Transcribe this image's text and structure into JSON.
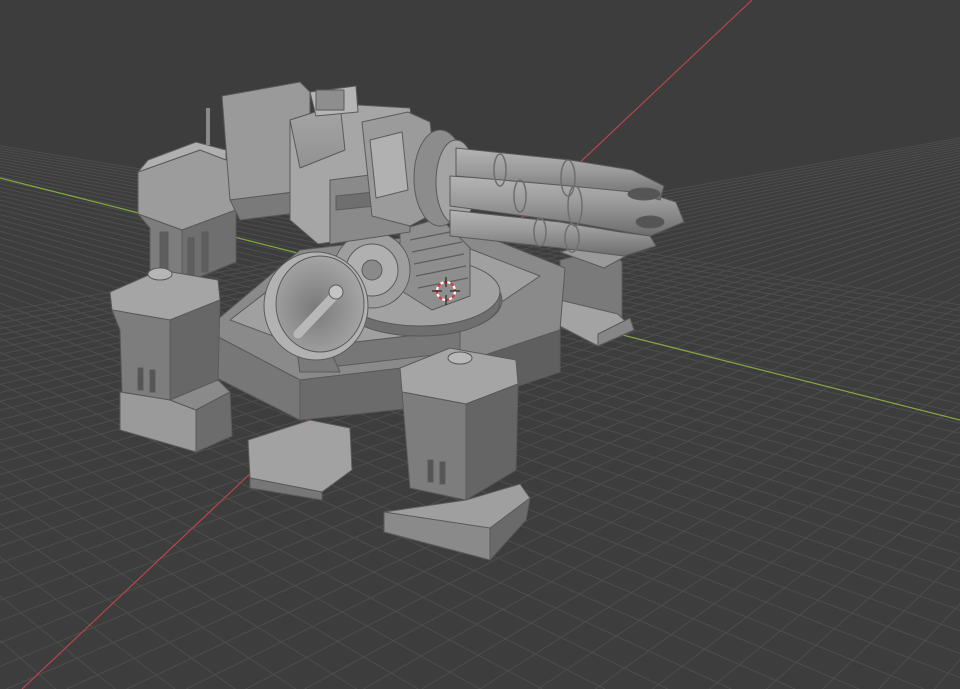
{
  "viewport": {
    "kind": "3D Viewport",
    "mode": "Solid shading",
    "background_color": "#3d3d3d",
    "grid_color": "#4d4d4d",
    "grid_minor_color": "#464646"
  },
  "axes": {
    "x_axis_color": "#b9444f",
    "y_axis_color": "#84a83f"
  },
  "scene": {
    "object": "turret",
    "parts": [
      "gatling-barrels",
      "gun-housing",
      "radar-dish",
      "rotating-turret-ring",
      "base-platform",
      "corner-pillar-front-left",
      "corner-pillar-front-right",
      "corner-pillar-back-left",
      "corner-pillar-back-right"
    ],
    "material_color": "#8f8f8f"
  },
  "cursor": {
    "name": "3d-cursor",
    "color_a": "#d43a3a",
    "color_b": "#ffffff"
  }
}
